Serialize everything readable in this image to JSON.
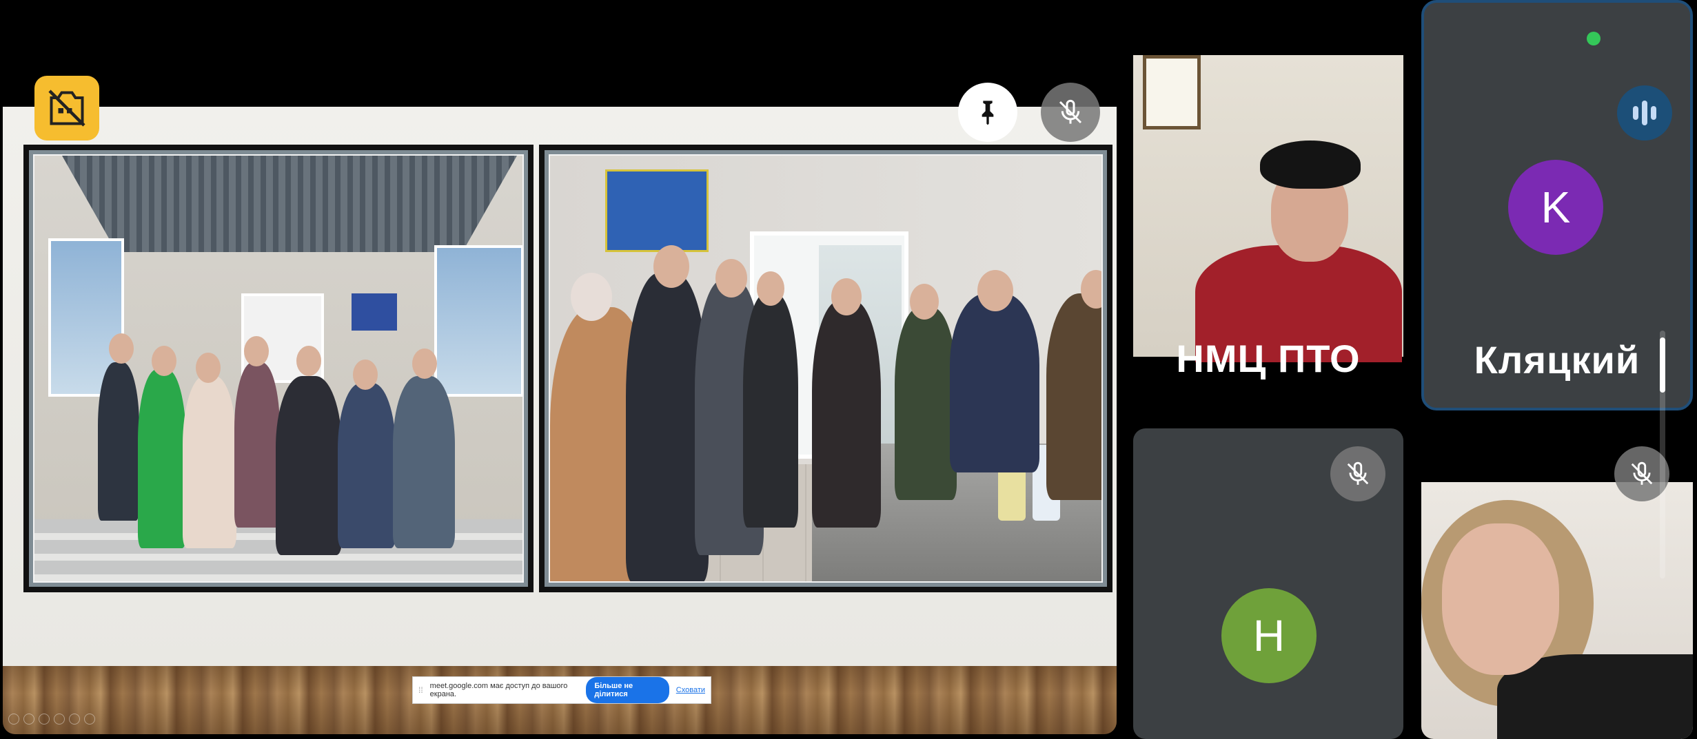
{
  "share_bar": {
    "message": "meet.google.com має доступ до вашого екрана.",
    "stop_label": "Більше не ділитися",
    "hide_label": "Сховати"
  },
  "participants": [
    {
      "name": "НМЦ ПТО",
      "video": true,
      "muted": false
    },
    {
      "name": "Кляцкий",
      "initial": "K",
      "avatar_color": "#7b2ab3",
      "speaking": true
    },
    {
      "name": "",
      "initial": "H",
      "avatar_color": "#6fa13a",
      "muted": true
    },
    {
      "name": "",
      "video": true,
      "muted": true
    }
  ],
  "icons": {
    "camera_off": "camera-off-icon",
    "pin": "pin-icon",
    "mic_off": "mic-off-icon",
    "speaking": "audio-level-icon"
  },
  "colors": {
    "accent": "#1a73e8",
    "camera_off_bg": "#f6bd2f",
    "active_border": "#1f4e79"
  }
}
